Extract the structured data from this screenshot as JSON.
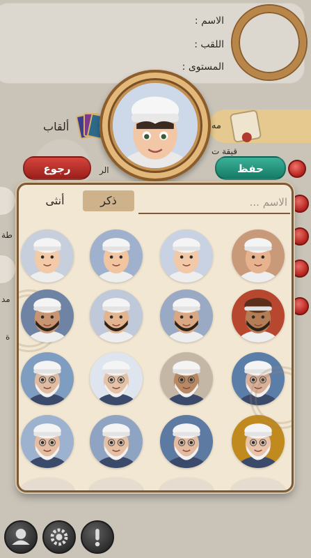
{
  "profile": {
    "name_label": "الاسم :",
    "title_label": "اللقب :",
    "level_label": "المستوى :"
  },
  "titles_section": {
    "label": "ألقاب",
    "partial_text_right": "مه",
    "partial_text_mid": "قيقة ت",
    "partial_text_far": "الر"
  },
  "buttons": {
    "back": "رجوع",
    "save": "حفظ"
  },
  "picker": {
    "tabs": {
      "male": "ذكر",
      "female": "أنثى"
    },
    "name_placeholder": "الاسم ...",
    "selected_tab": "male"
  },
  "left_partial_texts": {
    "a": "طة",
    "b": "مد",
    "c": "ة"
  },
  "bottom_nav": {
    "icons": [
      "profile-icon",
      "gear-icon",
      "alert-icon"
    ]
  },
  "colors": {
    "accent_gold": "#b98649",
    "save_green": "#1f8f77",
    "back_red": "#c0332c",
    "panel_bg": "#f2e7d2"
  }
}
